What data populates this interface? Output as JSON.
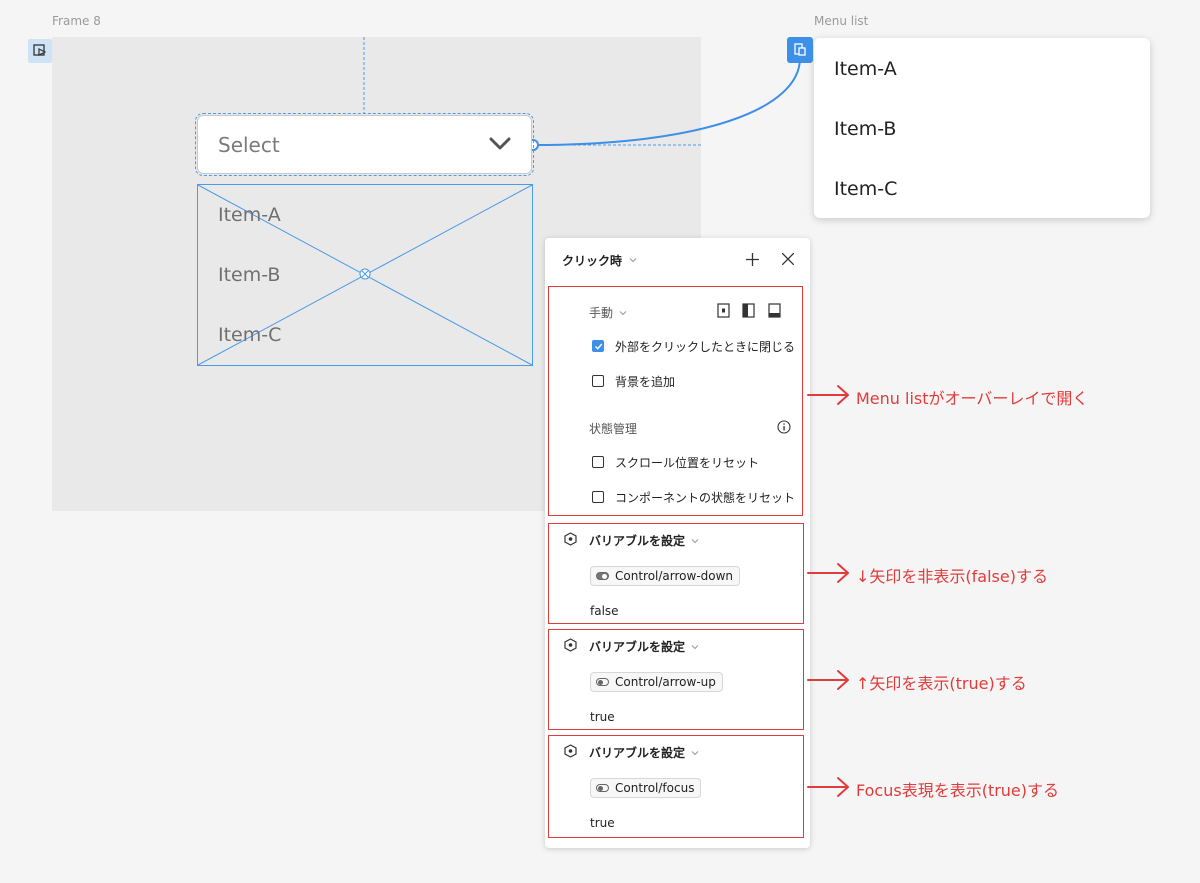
{
  "frames": {
    "frame8_label": "Frame 8",
    "menu_list_label": "Menu list"
  },
  "select": {
    "placeholder": "Select",
    "items": [
      "Item-A",
      "Item-B",
      "Item-C"
    ]
  },
  "menu_list": {
    "items": [
      "Item-A",
      "Item-B",
      "Item-C"
    ]
  },
  "panel": {
    "trigger": "クリック時",
    "manual": "手動",
    "close_on_outside": "外部をクリックしたときに閉じる",
    "close_on_outside_checked": true,
    "add_background": "背景を追加",
    "state_management": "状態管理",
    "reset_scroll": "スクロール位置をリセット",
    "reset_component": "コンポーネントの状態をリセット",
    "actions": [
      {
        "title": "バリアブルを設定",
        "variable": "Control/arrow-down",
        "value": "false",
        "toggle_on": true
      },
      {
        "title": "バリアブルを設定",
        "variable": "Control/arrow-up",
        "value": "true",
        "toggle_on": false
      },
      {
        "title": "バリアブルを設定",
        "variable": "Control/focus",
        "value": "true",
        "toggle_on": false
      }
    ]
  },
  "annotations": [
    "Menu listがオーバーレイで開く",
    "↓矢印を非表示(false)する",
    "↑矢印を表示(true)する",
    "Focus表現を表示(true)する"
  ],
  "colors": {
    "accent": "#3d8fe8",
    "annotation": "#e23b3b"
  }
}
